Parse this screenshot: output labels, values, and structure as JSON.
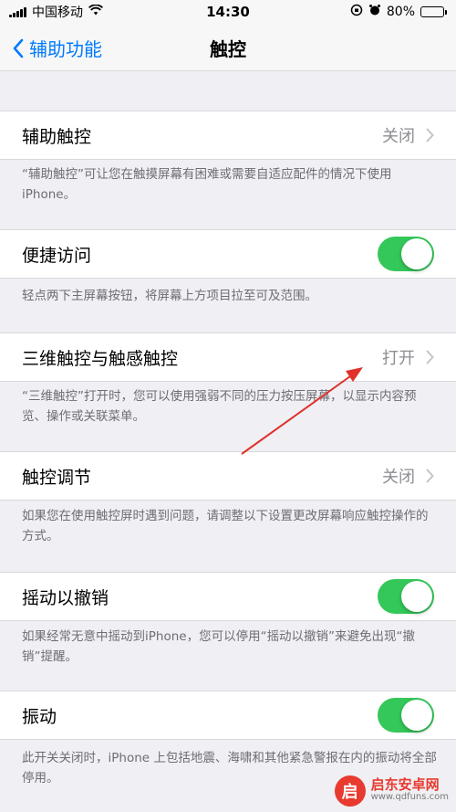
{
  "status_bar": {
    "carrier": "中国移动",
    "time": "14:30",
    "battery": "80%"
  },
  "nav": {
    "back_label": "辅助功能",
    "title": "触控"
  },
  "settings": [
    {
      "label": "辅助触控",
      "value": "关闭",
      "control": "disclosure",
      "footer": "“辅助触控”可让您在触摸屏幕有困难或需要自适应配件的情况下使用 iPhone。"
    },
    {
      "label": "便捷访问",
      "control": "toggle",
      "on": true,
      "footer": "轻点两下主屏幕按钮，将屏幕上方项目拉至可及范围。"
    },
    {
      "label": "三维触控与触感触控",
      "value": "打开",
      "control": "disclosure",
      "footer": "“三维触控”打开时，您可以使用强弱不同的压力按压屏幕，以显示内容预览、操作或关联菜单。"
    },
    {
      "label": "触控调节",
      "value": "关闭",
      "control": "disclosure",
      "footer": "如果您在使用触控屏时遇到问题，请调整以下设置更改屏幕响应触控操作的方式。"
    },
    {
      "label": "摇动以撤销",
      "control": "toggle",
      "on": true,
      "footer": "如果经常无意中摇动到iPhone，您可以停用“摇动以撤销”来避免出现“撤销”提醒。"
    },
    {
      "label": "振动",
      "control": "toggle",
      "on": true,
      "footer": "此开关关闭时，iPhone 上包括地震、海啸和其他紧急警报在内的振动将全部停用。"
    }
  ],
  "watermark": {
    "logo_char": "启",
    "name": "启东安卓网",
    "url": "www.qdfuns.com"
  },
  "colors": {
    "accent": "#007aff",
    "toggle_on": "#34c759",
    "annotation_arrow": "#e0312b"
  }
}
